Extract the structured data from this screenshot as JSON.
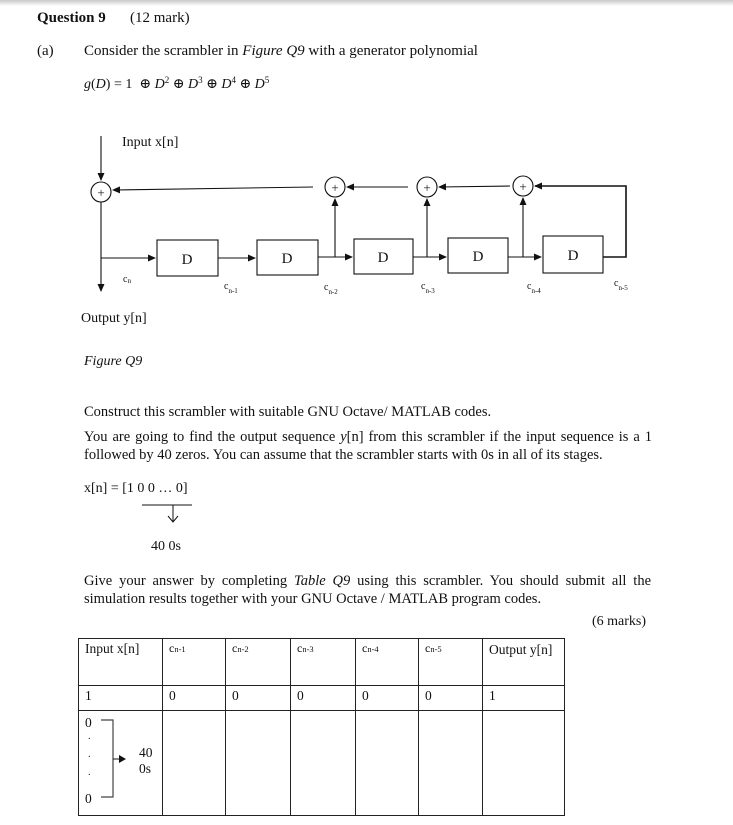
{
  "question": {
    "title": "Question 9",
    "marks_total": "(12 mark)"
  },
  "part_a": {
    "label": "(a)",
    "intro_prefix": "Consider the scrambler in ",
    "intro_figure_ref": "Figure Q9",
    "intro_suffix": " with a generator polynomial",
    "polynomial": {
      "lhs": "g(D) = 1",
      "terms": [
        {
          "base": "D",
          "exp": "2"
        },
        {
          "base": "D",
          "exp": "3"
        },
        {
          "base": "D",
          "exp": "4"
        },
        {
          "base": "D",
          "exp": "5"
        }
      ],
      "operator": "⊕"
    }
  },
  "figure": {
    "input_label": "Input x[n]",
    "output_label": "Output y[n]",
    "caption": "Figure Q9",
    "delay_label": "D",
    "adder_symbol": "+",
    "tap_labels": [
      {
        "base": "c",
        "sub": "n"
      },
      {
        "base": "c",
        "sub": "n-1"
      },
      {
        "base": "c",
        "sub": "n-2"
      },
      {
        "base": "c",
        "sub": "n-3"
      },
      {
        "base": "c",
        "sub": "n-4"
      },
      {
        "base": "c",
        "sub": "n-5"
      }
    ]
  },
  "instructions": {
    "construct": "Construct this scrambler with suitable GNU Octave/ MATLAB codes.",
    "task_prefix": "You are going to find the output sequence ",
    "task_var": "y",
    "task_suffix": "[n] from this scrambler if the input sequence is a 1 followed by 40 zeros. You can assume that the scrambler starts with 0s in all of its stages.",
    "input_seq": "x[n] = [1 0 0  … 0]",
    "zeros_note": "40 0s",
    "answer_prefix": "Give your answer by completing ",
    "answer_table_ref": "Table Q9",
    "answer_suffix": " using this scrambler. You should submit all the simulation results together with your GNU Octave / MATLAB program codes.",
    "part_marks": "(6 marks)"
  },
  "table": {
    "headers": [
      {
        "text": "Input x[n]"
      },
      {
        "base": "c",
        "sub": "n-1"
      },
      {
        "base": "c",
        "sub": "n-2"
      },
      {
        "base": "c",
        "sub": "n-3"
      },
      {
        "base": "c",
        "sub": "n-4"
      },
      {
        "base": "c",
        "sub": "n-5"
      },
      {
        "text": "Output y[n]"
      }
    ],
    "first_row": [
      "1",
      "0",
      "0",
      "0",
      "0",
      "0",
      "1"
    ],
    "second_row": {
      "input_top": "0",
      "input_dots": ".",
      "input_bottom": "0",
      "bracket_note_line1": "40",
      "bracket_note_line2": "0s"
    }
  }
}
